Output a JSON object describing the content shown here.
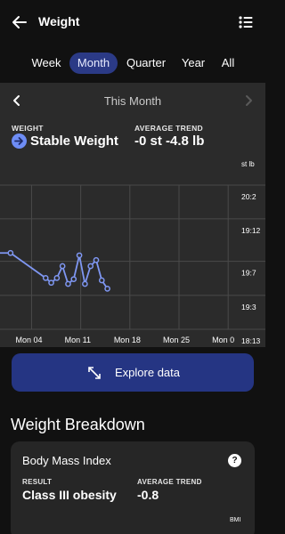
{
  "header": {
    "title": "Weight",
    "back_icon": "back-arrow-icon",
    "menu_icon": "list-icon"
  },
  "tabs": [
    {
      "label": "Week",
      "selected": false
    },
    {
      "label": "Month",
      "selected": true
    },
    {
      "label": "Quarter",
      "selected": false
    },
    {
      "label": "Year",
      "selected": false
    },
    {
      "label": "All",
      "selected": false
    }
  ],
  "period": {
    "label": "This Month",
    "prev_icon": "chevron-left-icon",
    "next_icon": "chevron-right-icon"
  },
  "summary": {
    "weight_label": "WEIGHT",
    "weight_value": "Stable Weight",
    "trend_label": "AVERAGE TREND",
    "trend_value": "-0 st -4.8 lb",
    "status_icon": "arrow-right-icon"
  },
  "chart_data": {
    "type": "line",
    "unit_label": "st lb",
    "y_tick_labels": [
      "20:2",
      "19:12",
      "19:7",
      "19:3",
      "18:13"
    ],
    "x_tick_labels": [
      "Mon 04",
      "Mon 11",
      "Mon 18",
      "Mon 25",
      "Mon 0"
    ],
    "series": [
      {
        "points": [
          {
            "x": -0.5,
            "y": 19.57
          },
          {
            "x": 1.0,
            "y": 19.57
          },
          {
            "x": 6.0,
            "y": 19.36
          },
          {
            "x": 6.8,
            "y": 19.32
          },
          {
            "x": 7.6,
            "y": 19.36
          },
          {
            "x": 8.4,
            "y": 19.46
          },
          {
            "x": 9.2,
            "y": 19.31
          },
          {
            "x": 10.0,
            "y": 19.35
          },
          {
            "x": 10.8,
            "y": 19.55
          },
          {
            "x": 11.6,
            "y": 19.31
          },
          {
            "x": 12.4,
            "y": 19.46
          },
          {
            "x": 13.2,
            "y": 19.51
          },
          {
            "x": 14.0,
            "y": 19.34
          },
          {
            "x": 14.8,
            "y": 19.27
          }
        ],
        "markers_from_index": 1,
        "color": "#7f97f2"
      }
    ],
    "x_tick_positions": [
      4,
      11,
      18,
      25,
      32
    ],
    "y_tick_values": [
      20.14,
      19.857,
      19.5,
      19.214,
      18.929
    ],
    "xlim": [
      -0.5,
      33.5
    ],
    "ylim": [
      18.929,
      20.14
    ],
    "grid": true,
    "colors": {
      "line": "#7f97f2",
      "grid": "#4a4a4a",
      "bg": "#2b2b2b"
    }
  },
  "explore": {
    "label": "Explore data",
    "icon": "expand-arrows-icon"
  },
  "breakdown": {
    "title": "Weight Breakdown"
  },
  "bmi": {
    "title": "Body Mass Index",
    "help_icon": "help-icon",
    "help_glyph": "?",
    "result_label": "RESULT",
    "result_value": "Class III obesity",
    "trend_label": "AVERAGE TREND",
    "trend_value": "-0.8",
    "axis_label": "BMI"
  }
}
